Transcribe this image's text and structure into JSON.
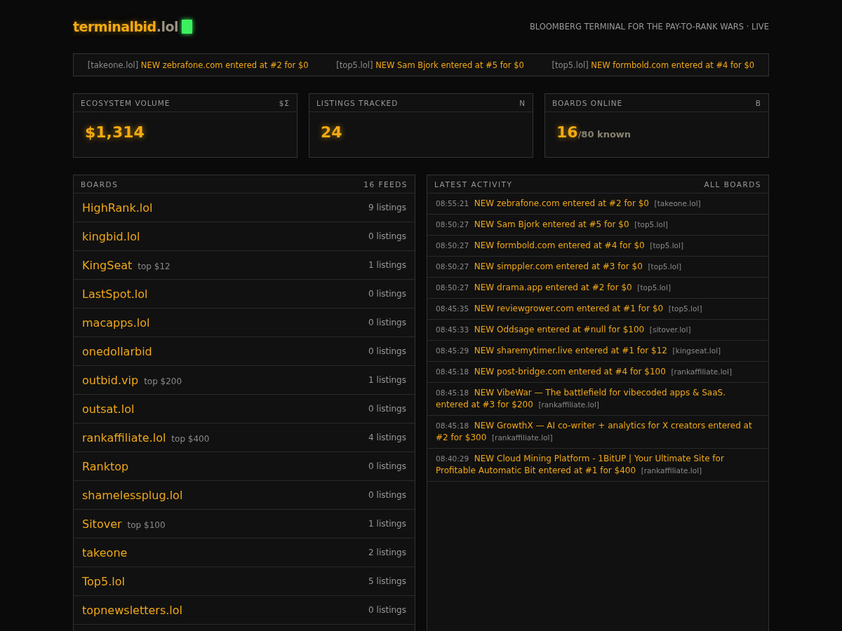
{
  "header": {
    "logo_name": "terminalbid",
    "logo_tld": ".lol",
    "tagline": "BLOOMBERG TERMINAL FOR THE PAY-TO-RANK WARS · LIVE"
  },
  "ticker": [
    {
      "board": "[takeone.lol]",
      "text": "NEW zebrafone.com entered at #2 for $0"
    },
    {
      "board": "[top5.lol]",
      "text": "NEW Sam Bjork entered at #5 for $0"
    },
    {
      "board": "[top5.lol]",
      "text": "NEW formbold.com entered at #4 for $0"
    }
  ],
  "stats": [
    {
      "label": "ECOSYSTEM VOLUME",
      "symbol": "$Σ",
      "value": "$1,314"
    },
    {
      "label": "LISTINGS TRACKED",
      "symbol": "N",
      "value": "24"
    },
    {
      "label": "BOARDS ONLINE",
      "symbol": "B",
      "value": "16",
      "suffix": "/80 known"
    }
  ],
  "boards": {
    "title": "BOARDS",
    "count": "16 FEEDS",
    "items": [
      {
        "name": "HighRank.lol",
        "listings": "9 listings"
      },
      {
        "name": "kingbid.lol",
        "listings": "0 listings"
      },
      {
        "name": "KingSeat",
        "top": "top $12",
        "listings": "1 listings"
      },
      {
        "name": "LastSpot.lol",
        "listings": "0 listings"
      },
      {
        "name": "macapps.lol",
        "listings": "0 listings"
      },
      {
        "name": "onedollarbid",
        "listings": "0 listings"
      },
      {
        "name": "outbid.vip",
        "top": "top $200",
        "listings": "1 listings"
      },
      {
        "name": "outsat.lol",
        "listings": "0 listings"
      },
      {
        "name": "rankaffiliate.lol",
        "top": "top $400",
        "listings": "4 listings"
      },
      {
        "name": "Ranktop",
        "listings": "0 listings"
      },
      {
        "name": "shamelessplug.lol",
        "listings": "0 listings"
      },
      {
        "name": "Sitover",
        "top": "top $100",
        "listings": "1 listings"
      },
      {
        "name": "takeone",
        "listings": "2 listings"
      },
      {
        "name": "Top5.lol",
        "listings": "5 listings"
      },
      {
        "name": "topnewsletters.lol",
        "listings": "0 listings"
      }
    ]
  },
  "activity": {
    "title": "LATEST ACTIVITY",
    "scope": "ALL BOARDS",
    "items": [
      {
        "time": "08:55:21",
        "text": "NEW zebrafone.com entered at #2 for $0",
        "board": "[takeone.lol]"
      },
      {
        "time": "08:50:27",
        "text": "NEW Sam Bjork entered at #5 for $0",
        "board": "[top5.lol]"
      },
      {
        "time": "08:50:27",
        "text": "NEW formbold.com entered at #4 for $0",
        "board": "[top5.lol]"
      },
      {
        "time": "08:50:27",
        "text": "NEW simppler.com entered at #3 for $0",
        "board": "[top5.lol]"
      },
      {
        "time": "08:50:27",
        "text": "NEW drama.app entered at #2 for $0",
        "board": "[top5.lol]"
      },
      {
        "time": "08:45:35",
        "text": "NEW reviewgrower.com entered at #1 for $0",
        "board": "[top5.lol]"
      },
      {
        "time": "08:45:33",
        "text": "NEW Oddsage entered at #null for $100",
        "board": "[sitover.lol]"
      },
      {
        "time": "08:45:29",
        "text": "NEW sharemytimer.live entered at #1 for $12",
        "board": "[kingseat.lol]"
      },
      {
        "time": "08:45:18",
        "text": "NEW post-bridge.com entered at #4 for $100",
        "board": "[rankaffiliate.lol]"
      },
      {
        "time": "08:45:18",
        "text": "NEW VibeWar — The battlefield for vibecoded apps & SaaS. entered at #3 for $200",
        "board": "[rankaffiliate.lol]"
      },
      {
        "time": "08:45:18",
        "text": "NEW GrowthX — AI co-writer + analytics for X creators entered at #2 for $300",
        "board": "[rankaffiliate.lol]"
      },
      {
        "time": "08:40:29",
        "text": "NEW Cloud Mining Platform - 1BitUP | Your Ultimate Site for Profitable Automatic Bit entered at #1 for $400",
        "board": "[rankaffiliate.lol]"
      }
    ]
  }
}
